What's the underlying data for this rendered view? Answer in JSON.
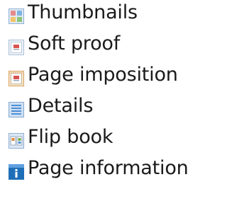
{
  "menu": {
    "items": [
      {
        "label": "Thumbnails",
        "icon": "thumbnails-grid-icon"
      },
      {
        "label": "Soft proof",
        "icon": "soft-proof-page-icon"
      },
      {
        "label": "Page imposition",
        "icon": "page-imposition-icon"
      },
      {
        "label": "Details",
        "icon": "details-list-icon"
      },
      {
        "label": "Flip book",
        "icon": "flip-book-icon"
      },
      {
        "label": "Page information",
        "icon": "page-information-icon"
      }
    ]
  },
  "colors": {
    "text": "#1a1a1a",
    "icon_blue": "#4f8fd6",
    "icon_dark_blue": "#1f6fb8",
    "icon_frame": "#9db8d6",
    "icon_orange": "#e08a3a",
    "icon_red": "#d9534f",
    "icon_green": "#6fb04b"
  }
}
